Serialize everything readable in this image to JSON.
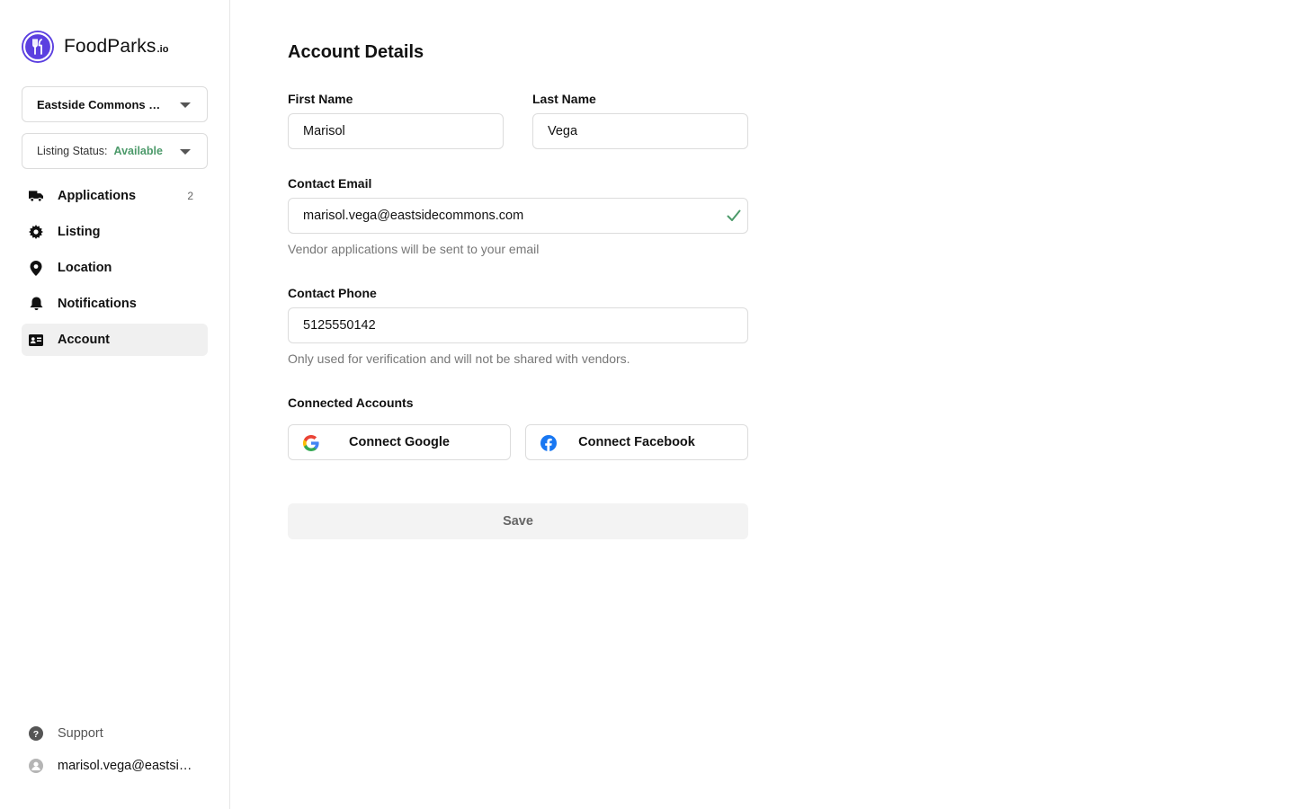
{
  "brand": {
    "name": "FoodParks",
    "suffix": ".io",
    "accent": "#5b3fe0"
  },
  "sidebar": {
    "park_select": {
      "value": "Eastside Commons Food Park"
    },
    "listing_status": {
      "label": "Listing Status:",
      "value": "Available",
      "value_color": "#4c9a6a"
    },
    "nav": [
      {
        "label": "Applications",
        "icon": "truck-icon",
        "count": "2"
      },
      {
        "label": "Listing",
        "icon": "gear-icon"
      },
      {
        "label": "Location",
        "icon": "map-pin-icon"
      },
      {
        "label": "Notifications",
        "icon": "bell-icon"
      },
      {
        "label": "Account",
        "icon": "id-card-icon",
        "active": true
      }
    ],
    "support": {
      "label": "Support",
      "icon": "help-circle-icon"
    },
    "user": {
      "email": "marisol.vega@eastsidecommons.com",
      "icon": "user-avatar-icon"
    }
  },
  "main": {
    "title": "Account Details",
    "first_name": {
      "label": "First Name",
      "value": "Marisol"
    },
    "last_name": {
      "label": "Last Name",
      "value": "Vega"
    },
    "email": {
      "label": "Contact Email",
      "value": "marisol.vega@eastsidecommons.com",
      "hint": "Vendor applications will be sent to your email",
      "verified_icon": "check-icon"
    },
    "phone": {
      "label": "Contact Phone",
      "value": "5125550142",
      "hint": "Only used for verification and will not be shared with vendors."
    },
    "connected": {
      "label": "Connected Accounts",
      "google": {
        "label": "Connect Google",
        "icon": "google-icon"
      },
      "facebook": {
        "label": "Connect Facebook",
        "icon": "facebook-icon"
      }
    },
    "save_label": "Save"
  }
}
